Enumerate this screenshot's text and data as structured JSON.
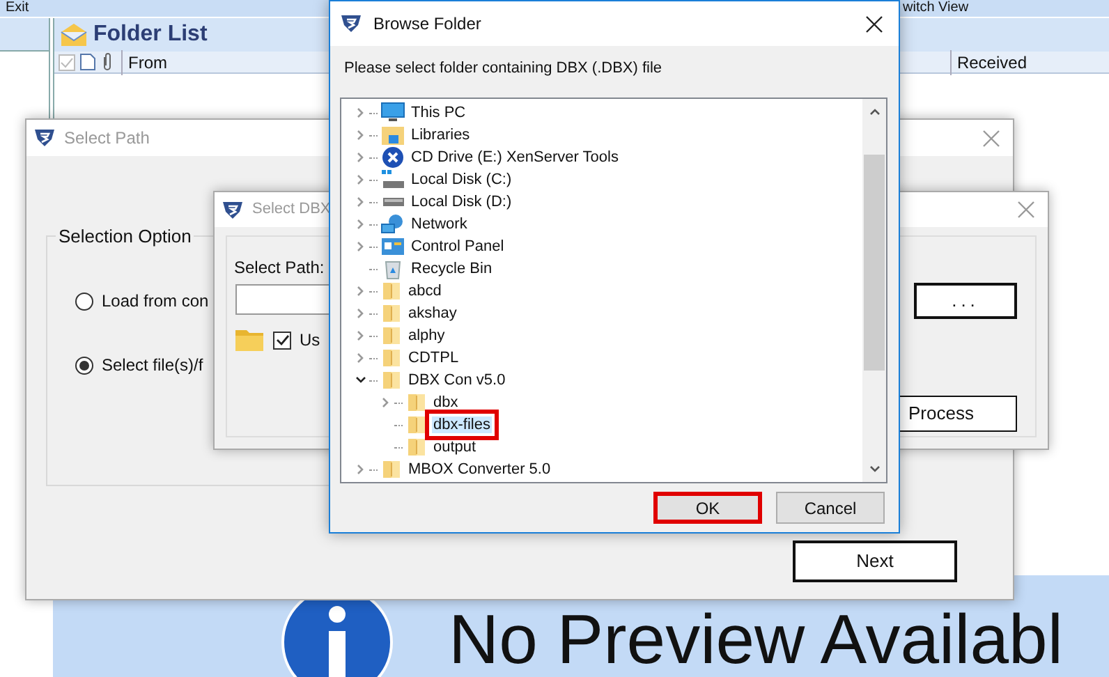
{
  "app": {
    "menu": "Exit",
    "switch_view": "witch View",
    "folder_list": {
      "title": "Folder List",
      "columns": [
        "From",
        "Received"
      ]
    },
    "preview": {
      "message": "No Preview Availabl"
    }
  },
  "select_path": {
    "title": "Select Path",
    "group": "Selection Option",
    "options": [
      {
        "label": "Load from con",
        "selected": false
      },
      {
        "label": "Select file(s)/f",
        "selected": true
      }
    ],
    "next": "Next"
  },
  "select_dbx": {
    "title": "Select DBX",
    "path_label": "Select Path:",
    "use_checkbox": {
      "label": "Us",
      "checked": true
    },
    "browse": "...",
    "process": "Process"
  },
  "browse_folder": {
    "title": "Browse Folder",
    "prompt": "Please select folder containing DBX (.DBX) file",
    "tree": [
      {
        "label": "This PC",
        "kind": "pc",
        "expanded": false,
        "selected": false,
        "highlighted": false
      },
      {
        "label": "Libraries",
        "kind": "libraries",
        "expanded": false,
        "selected": false,
        "highlighted": false
      },
      {
        "label": "CD Drive (E:) XenServer Tools",
        "kind": "cd",
        "expanded": false,
        "selected": false,
        "highlighted": false
      },
      {
        "label": "Local Disk (C:)",
        "kind": "system-disk",
        "expanded": false,
        "selected": false,
        "highlighted": false
      },
      {
        "label": "Local Disk (D:)",
        "kind": "disk",
        "expanded": false,
        "selected": false,
        "highlighted": false
      },
      {
        "label": "Network",
        "kind": "network",
        "expanded": false,
        "selected": false,
        "highlighted": false
      },
      {
        "label": "Control Panel",
        "kind": "control-panel",
        "expanded": false,
        "selected": false,
        "highlighted": false
      },
      {
        "label": "Recycle Bin",
        "kind": "recycle",
        "selected": false,
        "highlighted": false
      },
      {
        "label": "abcd",
        "kind": "folder",
        "expanded": false,
        "selected": false,
        "highlighted": false
      },
      {
        "label": "akshay",
        "kind": "folder",
        "expanded": false,
        "selected": false,
        "highlighted": false
      },
      {
        "label": "alphy",
        "kind": "folder",
        "expanded": false,
        "selected": false,
        "highlighted": false
      },
      {
        "label": "CDTPL",
        "kind": "folder",
        "expanded": false,
        "selected": false,
        "highlighted": false
      },
      {
        "label": "DBX Con v5.0",
        "kind": "folder",
        "expanded": true,
        "selected": false,
        "highlighted": false,
        "children": [
          {
            "label": "dbx",
            "kind": "folder",
            "expanded": false,
            "selected": false,
            "highlighted": false
          },
          {
            "label": "dbx-files",
            "kind": "folder",
            "selected": true,
            "highlighted": true
          },
          {
            "label": "output",
            "kind": "folder",
            "selected": false,
            "highlighted": false
          }
        ]
      },
      {
        "label": "MBOX Converter 5.0",
        "kind": "folder",
        "expanded": false,
        "selected": false,
        "highlighted": false
      }
    ],
    "buttons": [
      {
        "label": "OK",
        "highlighted": true
      },
      {
        "label": "Cancel",
        "highlighted": false
      }
    ]
  }
}
